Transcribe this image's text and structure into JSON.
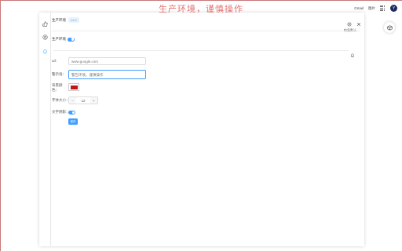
{
  "watermark": "生产环境，谨慎操作",
  "google_bar": {
    "gmail": "Gmail",
    "images": "图片",
    "avatar_letter": "Y"
  },
  "panel": {
    "title": "生产环境",
    "tag": "v1.0",
    "reset": "恢复默认",
    "toggle_label": "生产环境",
    "toggle_on": true
  },
  "form": {
    "url_label": "url:",
    "url_value": "www.google.com",
    "tip_label": "警示语：",
    "tip_value": "警告环境，谨慎操作",
    "color_label": "背景颜色：",
    "color_value": "#c01818",
    "font_size_label": "字体大小：",
    "font_size_value": "12",
    "minus": "−",
    "plus": "+",
    "text_toggle_label": "文字阴影：",
    "text_toggle_on": true,
    "save_label": "保存"
  },
  "colors": {
    "accent": "#409eff",
    "warning_text": "#e05a5a"
  }
}
